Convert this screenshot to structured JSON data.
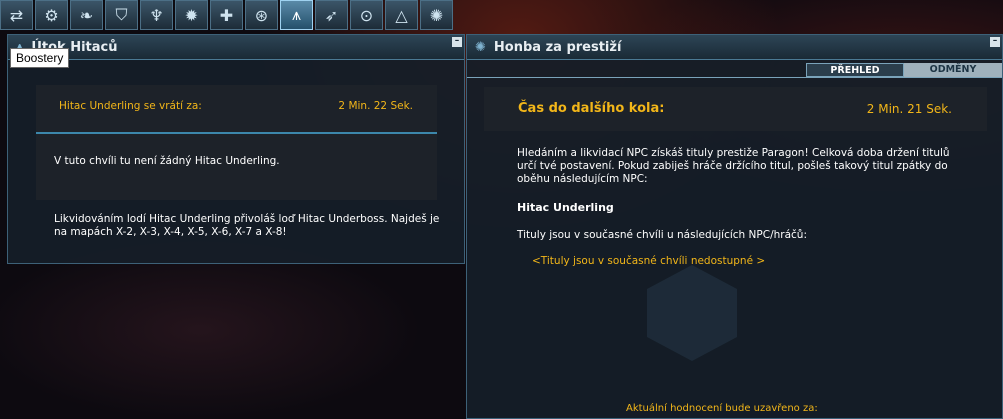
{
  "toolbar": {
    "icons": [
      "arrows-swap-icon",
      "settings-gear-icon",
      "wing-emblem-icon",
      "shield-icon",
      "trophy-icon",
      "star-emblem-icon",
      "puzzle-icon",
      "winged-emblem-icon",
      "ship-icon",
      "ship-arrow-icon",
      "ship-circle-icon",
      "triangle-icon",
      "burst-icon"
    ],
    "active_index": 8
  },
  "tooltip": "Boostery",
  "left_window": {
    "title": "Útok Hitaců",
    "timer_label": "Hitac Underling se vrátí za:",
    "timer_value": "2 Min. 22 Sek.",
    "status": "V tuto chvíli tu není žádný Hitac Underling.",
    "info": "Likvidováním lodí Hitac Underling přivoláš loď Hitac Underboss. Najdeš je na mapách X-2, X-3, X-4, X-5, X-6, X-7 a X-8!"
  },
  "right_window": {
    "title": "Honba za prestiží",
    "tabs": [
      "PŘEHLED",
      "ODMĚNY"
    ],
    "active_tab": 0,
    "round_label": "Čas do dalšího kola:",
    "round_value": "2 Min. 21 Sek.",
    "description": "Hledáním a likvidací NPC získáš tituly prestiže Paragon! Celková doba držení titulů určí tvé postavení. Pokud zabiješ hráče držícího titul, pošleš takový titul zpátky do oběhu následujícím NPC:",
    "npc_name": "Hitac Underling",
    "holders_label": "Tituly jsou v současné chvíli u následujících NPC/hráčů:",
    "unavailable": "<Tituly jsou v současné chvíli nedostupné >",
    "closing_label": "Aktuální hodnocení bude uzavřeno za:"
  },
  "colors": {
    "accent": "#f2b619",
    "panel": "#1d2229",
    "frame": "#3d6178"
  }
}
